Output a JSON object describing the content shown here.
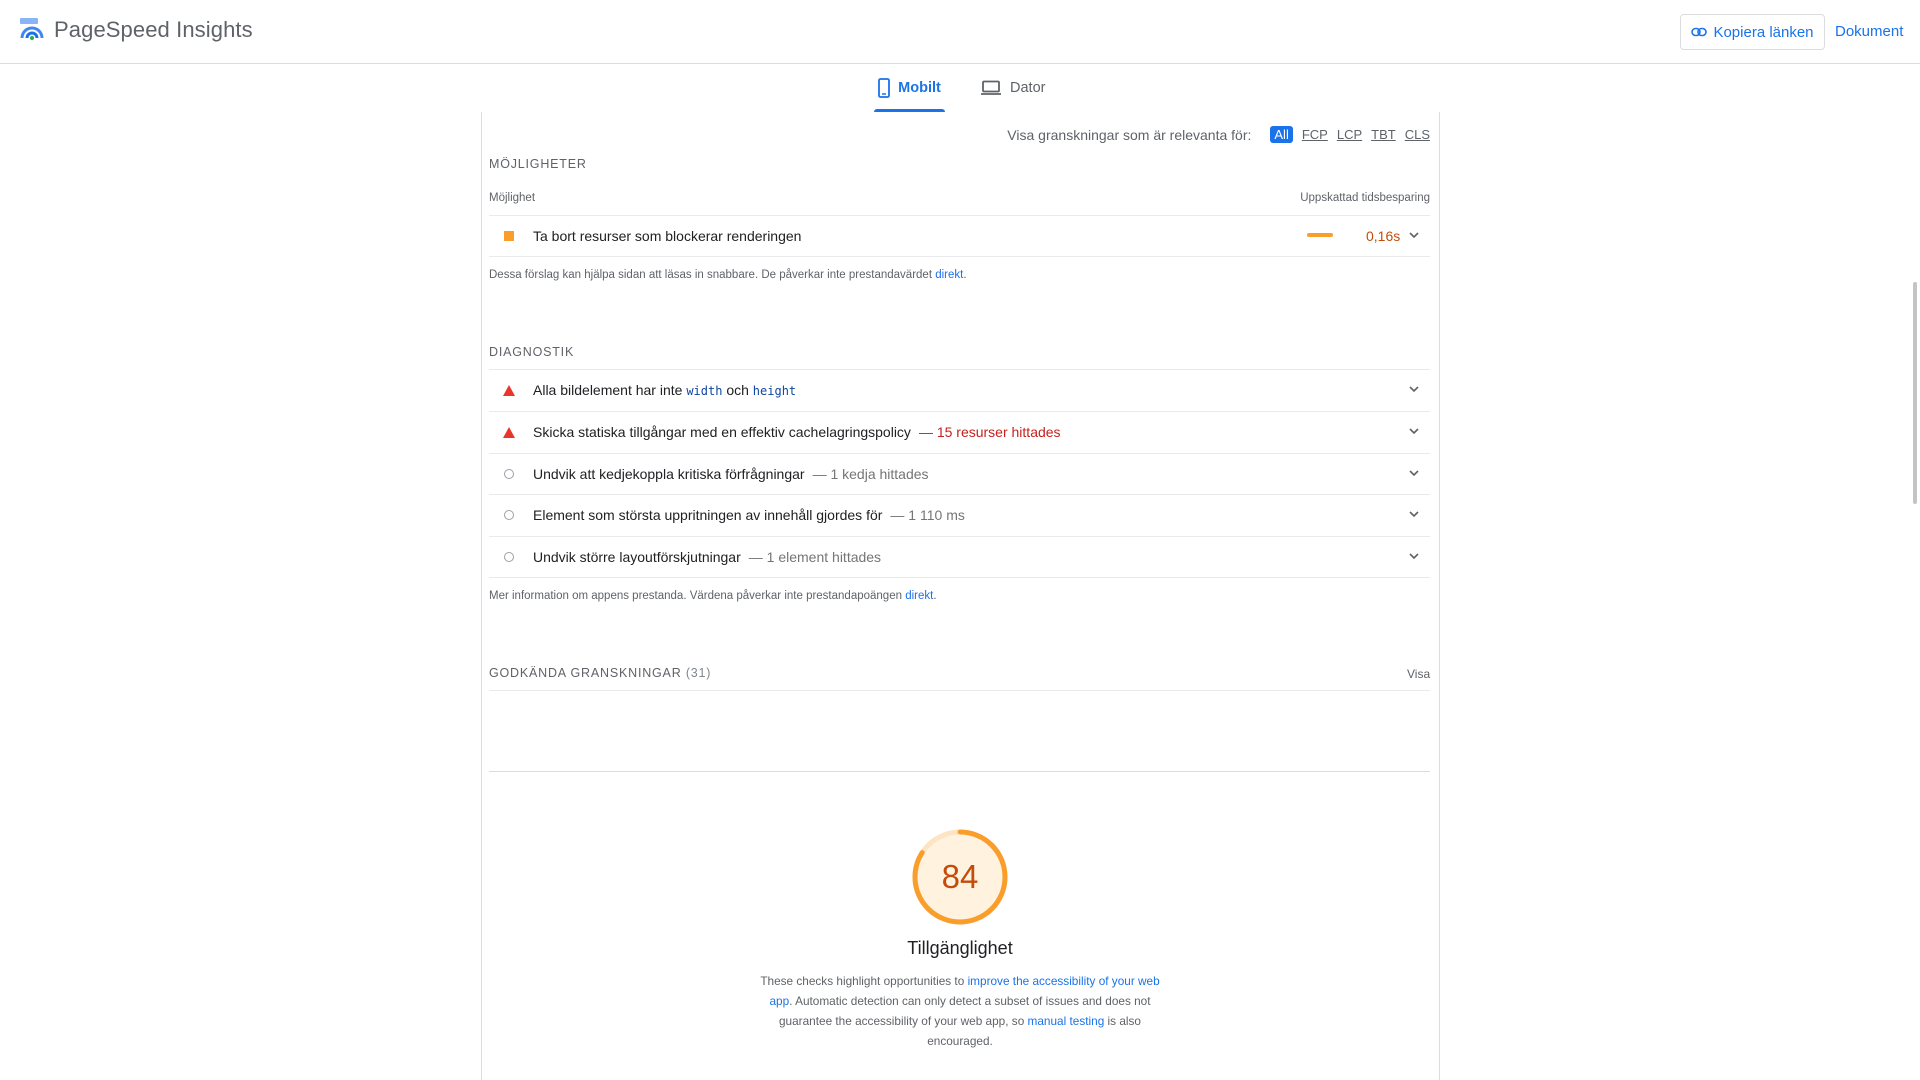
{
  "header": {
    "app_name": "PageSpeed Insights",
    "copy_link_label": "Kopiera länken",
    "docs_label": "Dokument"
  },
  "tabs": {
    "mobile": "Mobilt",
    "desktop": "Dator"
  },
  "filter": {
    "label": "Visa granskningar som är relevanta för:",
    "options": [
      "All",
      "FCP",
      "LCP",
      "TBT",
      "CLS"
    ],
    "selected": "All"
  },
  "opportunities": {
    "section_title": "MÖJLIGHETER",
    "col_left": "Möjlighet",
    "col_right": "Uppskattad tidsbesparing",
    "items": [
      {
        "title": "Ta bort resurser som blockerar renderingen",
        "savings": "0,16s",
        "status": "average"
      }
    ],
    "note": "Dessa förslag kan hjälpa sidan att läsas in snabbare. De påverkar inte prestandavärdet ",
    "note_link": "direkt",
    "note_end": "."
  },
  "diagnostics": {
    "section_title": "DIAGNOSTIK",
    "items": [
      {
        "status": "fail",
        "title_pre": "Alla bildelement har inte ",
        "code1": "width",
        "title_mid": " och ",
        "code2": "height",
        "detail": ""
      },
      {
        "status": "fail",
        "title": "Skicka statiska tillgångar med en effektiv cachelagringspolicy",
        "detail": "— 15 resurser hittades"
      },
      {
        "status": "info",
        "title": "Undvik att kedjekoppla kritiska förfrågningar",
        "detail": "— 1 kedja hittades"
      },
      {
        "status": "info",
        "title": "Element som största uppritningen av innehåll gjordes för",
        "detail": "— 1 110 ms"
      },
      {
        "status": "info",
        "title": "Undvik större layoutförskjutningar",
        "detail": "— 1 element hittades"
      }
    ],
    "note": "Mer information om appens prestanda. Värdena påverkar inte prestandapoängen ",
    "note_link": "direkt",
    "note_end": "."
  },
  "passed": {
    "title": "GODKÄNDA GRANSKNINGAR",
    "count": "(31)",
    "show_label": "Visa"
  },
  "accessibility": {
    "score": 84,
    "title": "Tillgänglighet",
    "desc_1": "These checks highlight opportunities to ",
    "desc_link_1": "improve the accessibility of your web app",
    "desc_2": ". Automatic detection can only detect a subset of issues and does not guarantee the accessibility of your web app, so ",
    "desc_link_2": "manual testing",
    "desc_3": " is also encouraged."
  },
  "colors": {
    "accent": "#1a73e8",
    "average": "#fa9e2b",
    "average_text": "#c44c0b",
    "fail": "#e8362d",
    "fail_text": "#c5221f"
  }
}
